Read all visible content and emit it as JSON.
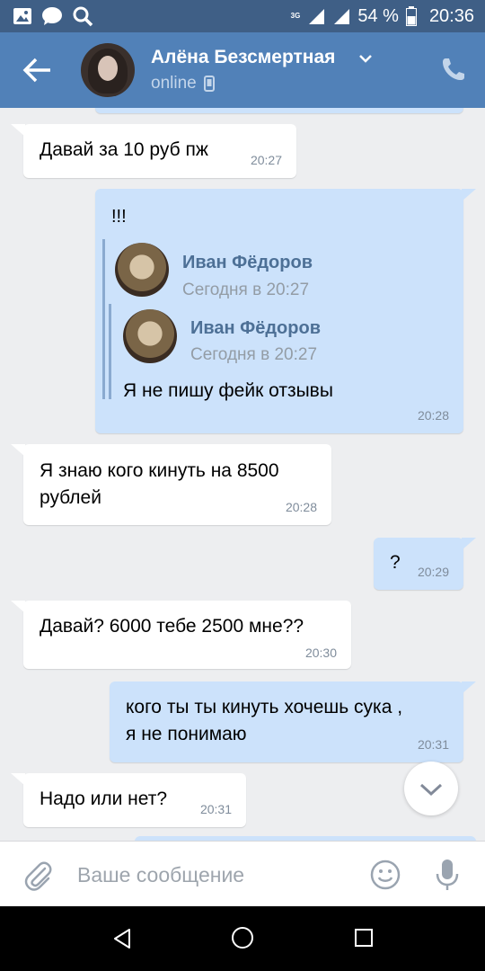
{
  "status_bar": {
    "network": "3G",
    "battery": "54 %",
    "time": "20:36"
  },
  "header": {
    "name": "Алёна Безсмертная",
    "status": "online"
  },
  "messages": [
    {
      "dir": "in",
      "text": "Давай за 10 руб пж",
      "time": "20:27"
    },
    {
      "dir": "out",
      "text": "!!!",
      "time": "20:28",
      "forward": {
        "name": "Иван Фёдоров",
        "date": "Сегодня в 20:27",
        "inner": {
          "name": "Иван Фёдоров",
          "date": "Сегодня в 20:27",
          "text": "Я не пишу фейк отзывы"
        }
      }
    },
    {
      "dir": "in",
      "text_line1": "Я знаю кого кинуть на 8500",
      "text_line2": "рублей",
      "time": "20:28"
    },
    {
      "dir": "out",
      "text": "?",
      "time": "20:29"
    },
    {
      "dir": "in",
      "text": "Давай? 6000 тебе 2500 мне??",
      "time": "20:30"
    },
    {
      "dir": "out",
      "text_line1": "кого ты ты кинуть хочешь сука ,",
      "text_line2": "я не понимаю",
      "time": "20:31"
    },
    {
      "dir": "in",
      "text": "Надо или нет?",
      "time": "20:31"
    }
  ],
  "compose": {
    "placeholder": "Ваше сообщение"
  },
  "colors": {
    "header": "#5181b8",
    "status_bar": "#3f5f86",
    "out_bubble": "#cce2fb",
    "in_bubble": "#ffffff",
    "background": "#edeef0",
    "link_name": "#4d7096"
  },
  "icons": [
    "image-icon",
    "chat-icon",
    "search-icon",
    "signal-icon",
    "battery-icon",
    "back-arrow-icon",
    "chevron-down-icon",
    "phone-icon",
    "mobile-icon",
    "chevron-down-icon",
    "paperclip-icon",
    "emoji-icon",
    "microphone-icon",
    "nav-back-icon",
    "nav-home-icon",
    "nav-recent-icon"
  ]
}
